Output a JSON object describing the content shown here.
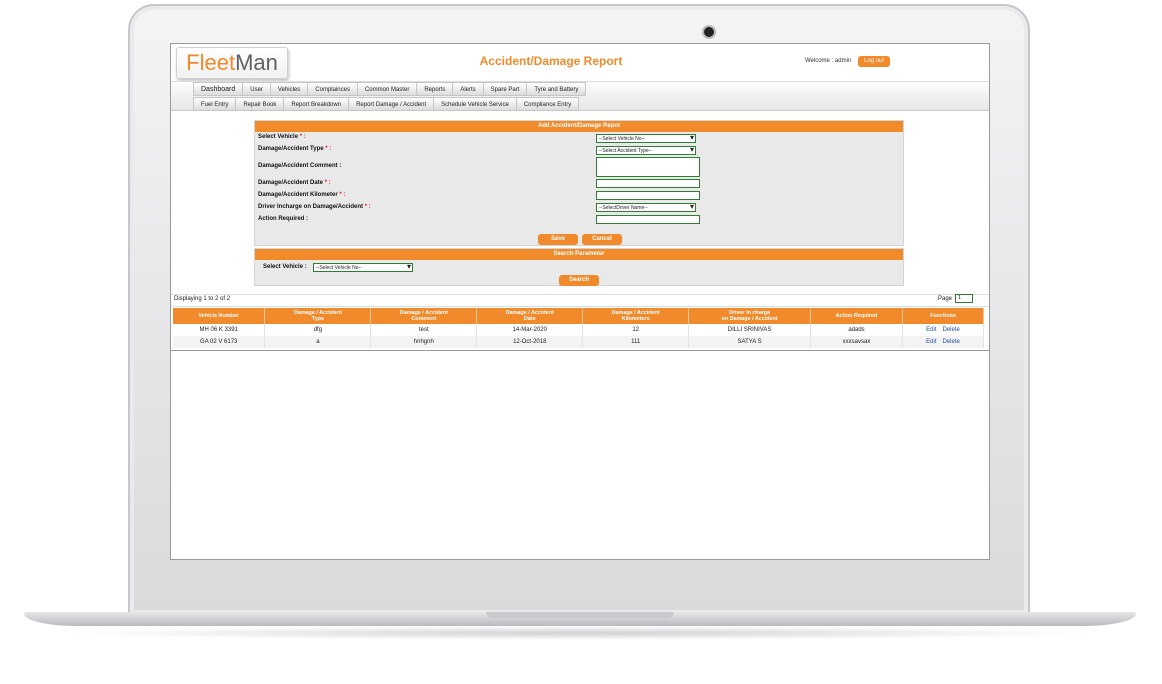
{
  "app": {
    "logo_part1": "Fleet",
    "logo_part2": "Man",
    "page_title": "Accident/Damage Report",
    "welcome_text": "Welcome : admin",
    "logout_label": "Log out",
    "accent_color": "#f18a2b"
  },
  "menu": {
    "row1": [
      "Dashboard",
      "User",
      "Vehicles",
      "Complainces",
      "Common Master",
      "Reports",
      "Alerts",
      "Spare Part",
      "Tyre and Battery"
    ],
    "row2": [
      "Fuel Entry",
      "Repair Book",
      "Report Breakdown",
      "Report Damage / Accident",
      "Schedule Vehicle Service",
      "Compliance Entry"
    ]
  },
  "form": {
    "header": "Add Accident/Damage Repot",
    "labels": {
      "vehicle": "Select Vehicle",
      "type": "Damage/Accident Type",
      "comment": "Damage/Accident Comment :",
      "date": "Damage/Accident Date",
      "km": "Damage/Accident Kilometer",
      "driver": "Driver Incharge on Damage/Accident",
      "action": "Action Required :"
    },
    "required_mark": "* :",
    "vehicle_select": "--Select Vehicle No--",
    "type_select": "--Select Accident Type--",
    "driver_select": "--SelectDriver Name--",
    "save_label": "Save",
    "cancel_label": "Cancel"
  },
  "search": {
    "header": "Search Parameter",
    "vehicle_label": "Select Vehicle :",
    "vehicle_select": "--Select Vehicle No--",
    "search_label": "Search"
  },
  "results": {
    "displaying": "Displaying 1 to 2 of 2",
    "page_label": "Page",
    "page_value": "1",
    "columns": [
      [
        "Vehicle Number",
        ""
      ],
      [
        "Damage / Accident",
        "Type"
      ],
      [
        "Damage / Accident",
        "Comment"
      ],
      [
        "Damage / Accident",
        "Date"
      ],
      [
        "Damage / Accident",
        "Kilometers"
      ],
      [
        "Driver In charge",
        "on Damage / Accident"
      ],
      [
        "Action Required",
        ""
      ],
      [
        "Functions",
        ""
      ]
    ],
    "rows": [
      [
        "MH 06 K 3391",
        "dfg",
        "test",
        "14-Mar-2020",
        "12",
        "DILLI SRINIVAS",
        "adads"
      ],
      [
        "GA 02 V 6173",
        "a",
        "hnhgnh",
        "12-Oct-2018",
        "111",
        "SATYA S",
        "xxxsavsax"
      ]
    ],
    "edit_label": "Edit",
    "delete_label": "Delete"
  }
}
